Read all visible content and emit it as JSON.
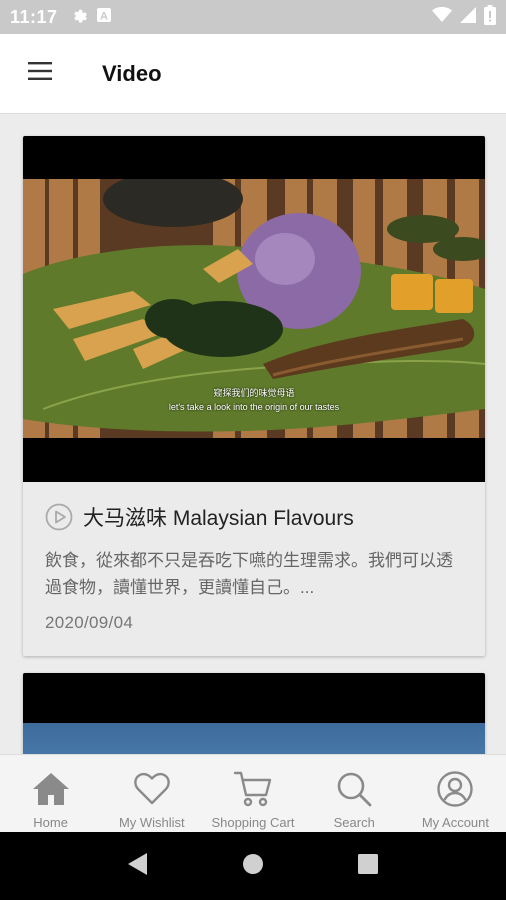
{
  "status_bar": {
    "time": "11:17",
    "left_icons": [
      "gear-icon",
      "a-letter-icon"
    ],
    "right_icons": [
      "wifi-icon",
      "signal-icon",
      "battery-icon"
    ],
    "background": "#c9c9c9"
  },
  "app_bar": {
    "menu_icon": "hamburger-menu-icon",
    "title": "Video"
  },
  "videos": [
    {
      "subtitle_cn": "窥探我们的味觉母语",
      "subtitle_en": "let's take a look into the origin of our tastes",
      "title": "大马滋味 Malaysian Flavours",
      "description": "飲食，從來都不只是吞吃下嚥的生理需求。我們可以透過食物，讀懂世界，更讀懂自己。...",
      "date": "2020/09/04"
    }
  ],
  "bottom_nav": {
    "items": [
      {
        "label": "Home",
        "icon": "home-icon"
      },
      {
        "label": "My Wishlist",
        "icon": "heart-icon"
      },
      {
        "label": "Shopping Cart",
        "icon": "cart-icon"
      },
      {
        "label": "Search",
        "icon": "search-icon"
      },
      {
        "label": "My Account",
        "icon": "account-icon"
      }
    ]
  },
  "system_nav": {
    "items": [
      "back-icon",
      "home-circle-icon",
      "recents-icon"
    ]
  },
  "colors": {
    "accent": "#111111",
    "nav_icon": "#8a8a8a",
    "background": "#ececec"
  }
}
